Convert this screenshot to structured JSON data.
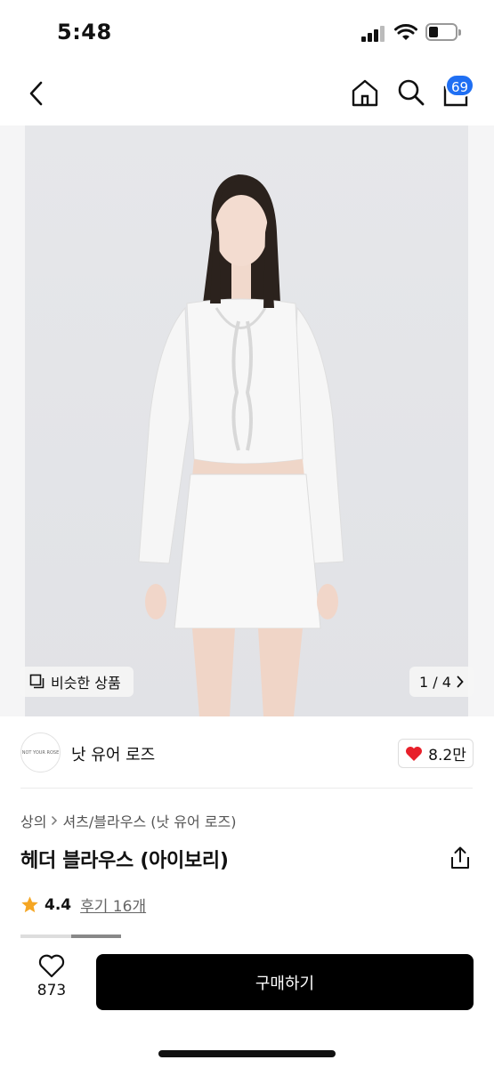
{
  "status_bar": {
    "time": "5:48",
    "icons": [
      "signal-icon",
      "wifi-icon",
      "battery-icon"
    ]
  },
  "nav": {
    "icons": [
      "back-icon",
      "home-icon",
      "search-icon",
      "cart-icon"
    ],
    "cart_badge": "69"
  },
  "product_image": {
    "similar_label": "비슷한 상품",
    "page_indicator": "1 / 4"
  },
  "brand": {
    "logo_text": "NOT YOUR ROSE",
    "name": "낫 유어 로즈",
    "like_count": "8.2만"
  },
  "breadcrumb": {
    "items": [
      "상의",
      "셔츠/블라우스 (낫 유어 로즈)"
    ]
  },
  "product": {
    "title": "헤더 블라우스 (아이보리)"
  },
  "rating": {
    "value": "4.4",
    "reviews": "후기 16개"
  },
  "bottom": {
    "wish_count": "873",
    "buy_label": "구매하기"
  },
  "colors": {
    "badge": "#1f6ff3",
    "heart": "#e8202a",
    "star": "#f5a623",
    "buy_button": "#000000"
  }
}
